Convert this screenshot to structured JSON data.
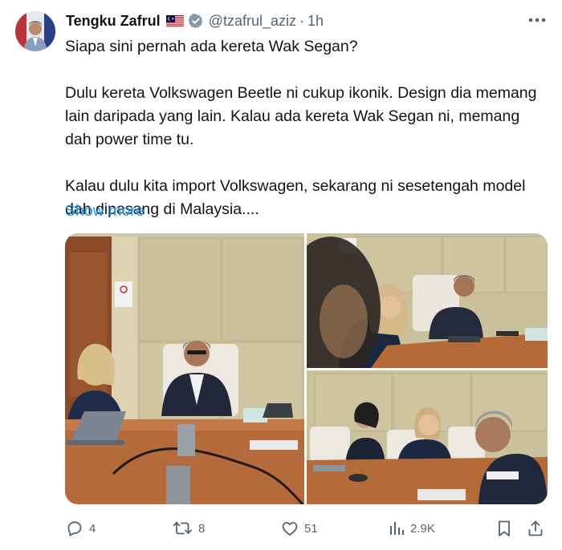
{
  "author": {
    "name": "Tengku Zafrul",
    "handle": "@tzafrul_aziz",
    "separator": "·",
    "time": "1h"
  },
  "tweet": {
    "line1": "Siapa sini pernah ada kereta Wak Segan?",
    "para2": "Dulu kereta Volkswagen Beetle ni cukup ikonik. Design dia memang lain daripada yang lain. Kalau ada kereta Wak Segan ni, memang dah power time tu.",
    "para3": "Kalau dulu kita import Volkswagen, sekarang ni sesetengah model dah dipasang di Malaysia....",
    "show_more": "Show more"
  },
  "stats": {
    "replies": "4",
    "retweets": "8",
    "likes": "51",
    "views": "2.9K"
  },
  "colors": {
    "accent": "#1d9bf0",
    "text": "#0f1419",
    "muted": "#536471"
  }
}
